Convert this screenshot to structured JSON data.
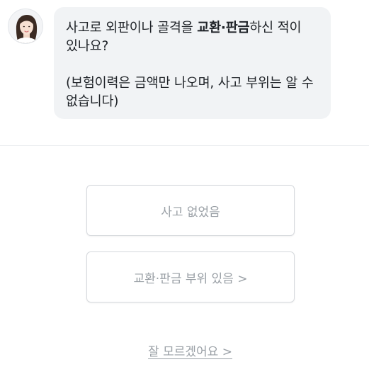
{
  "chat": {
    "avatar_icon": "agent-avatar",
    "message_line1_prefix": "사고로 외판이나 골격을 ",
    "message_line1_bold": "교환·판금",
    "message_line1_suffix": "하신 적이",
    "message_line2": "있나요?",
    "message_note_line1": "(보험이력은 금액만 나오며, 사고 부위는 알 수",
    "message_note_line2": "없습니다)"
  },
  "options": {
    "no_accident": "사고 없었음",
    "has_replacement": "교환·판금 부위 있음 >",
    "dont_know": "잘 모르겠어요 >"
  },
  "colors": {
    "bubble_bg": "#f1f3f5",
    "text_primary": "#1f2328",
    "text_muted": "#9aa0a6",
    "border": "#d6d9dd"
  }
}
